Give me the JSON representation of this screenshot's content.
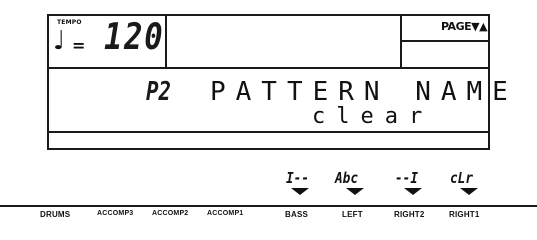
{
  "tempo": {
    "label": "TEMPO",
    "note_symbol": "♩",
    "equals": "=",
    "value": "120"
  },
  "page_indicator": "PAGE▼▲",
  "pattern": {
    "number": "P2",
    "title": "PATTERN NAME",
    "value": "clear"
  },
  "softkeys": [
    {
      "label": "I--"
    },
    {
      "label": "Abc"
    },
    {
      "label": "--I"
    },
    {
      "label": "cLr"
    }
  ],
  "tracks": [
    {
      "label": "DRUMS"
    },
    {
      "label": "ACCOMP3"
    },
    {
      "label": "ACCOMP2"
    },
    {
      "label": "ACCOMP1"
    },
    {
      "label": "BASS"
    },
    {
      "label": "LEFT"
    },
    {
      "label": "RIGHT2"
    },
    {
      "label": "RIGHT1"
    }
  ],
  "colors": {
    "lcd_ink": "#1a1a1a",
    "background": "#ffffff"
  }
}
